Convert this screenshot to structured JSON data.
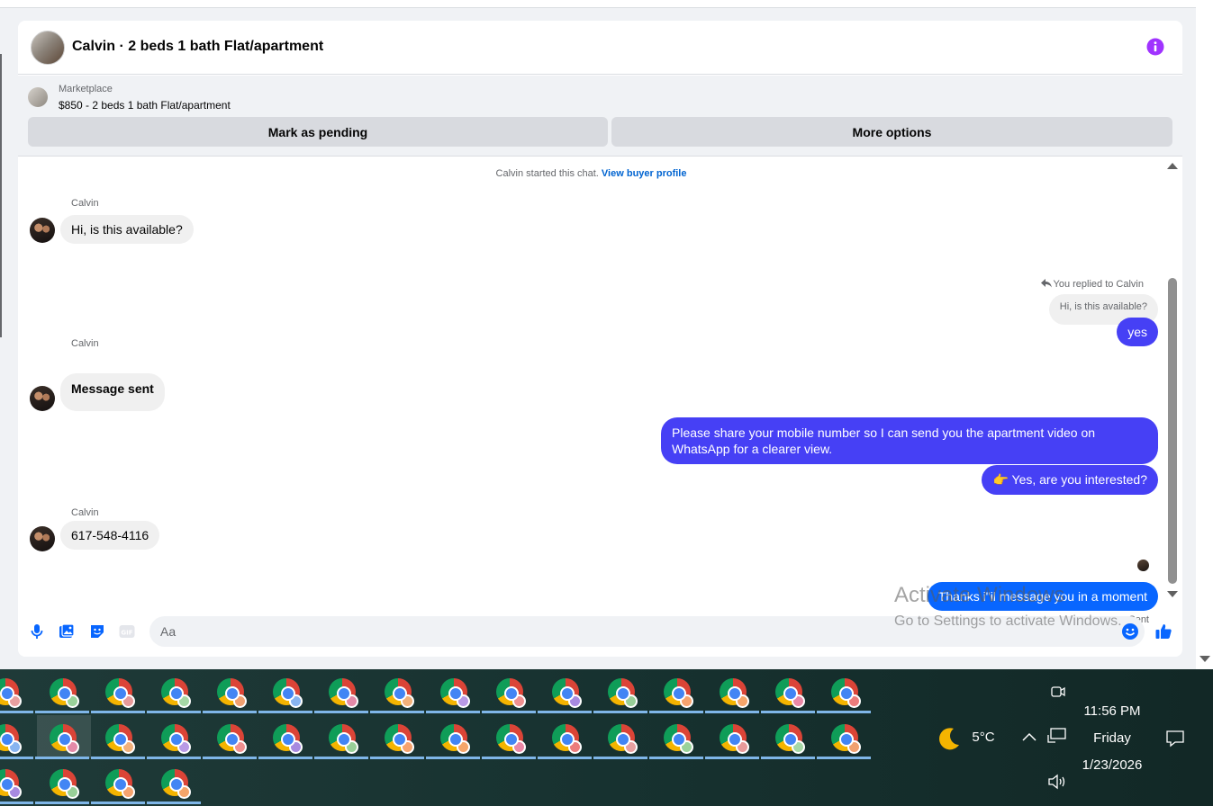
{
  "header": {
    "title": "Calvin · 2 beds 1 bath Flat/apartment"
  },
  "listing": {
    "category": "Marketplace",
    "price_title": "$850 - 2 beds 1 bath Flat/apartment",
    "mark_pending_label": "Mark as pending",
    "more_options_label": "More options"
  },
  "chat": {
    "started_text": "Calvin started this chat.",
    "view_profile_link": "View buyer profile",
    "messages": [
      {
        "sender": "Calvin",
        "text": "Hi, is this available?"
      },
      {
        "reply_label": "You replied to Calvin",
        "quoted": "Hi, is this available?",
        "text": "yes"
      },
      {
        "sender": "Calvin",
        "text": "Message sent"
      },
      {
        "text": "Please share your mobile number so I can send you the apartment video on WhatsApp for a clearer view."
      },
      {
        "text": "👉 Yes, are you interested?"
      },
      {
        "sender": "Calvin",
        "text": "617-548-4116"
      },
      {
        "text": "Thanks i\"il message you in a moment",
        "status": "Sent"
      }
    ]
  },
  "composer": {
    "placeholder": "Aa"
  },
  "watermark": {
    "line1": "Activate Windows",
    "line2": "Go to Settings to activate Windows."
  },
  "taskbar": {
    "weather_temp": "5°C",
    "time": "11:56 PM",
    "day": "Friday",
    "date": "1/23/2026"
  },
  "colors": {
    "outgoing_bubble": "#4640f5",
    "last_outgoing_bubble": "#0866ff",
    "info_icon": "#a033ff",
    "link": "#0064d1"
  }
}
